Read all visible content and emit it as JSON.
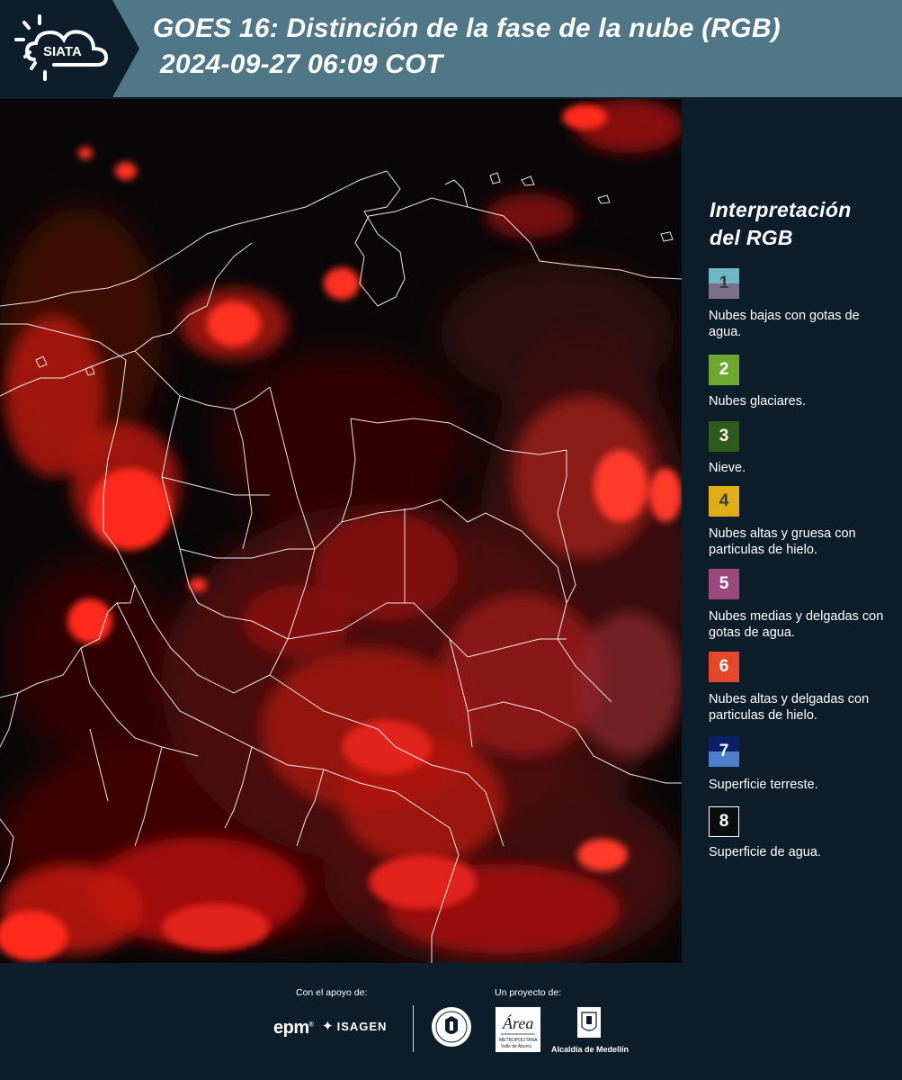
{
  "header": {
    "logo_text": "SIATA",
    "title_line1": "GOES 16: Distinción de la fase de la nube (RGB)",
    "title_line2": "2024-09-27 06:09 COT"
  },
  "legend": {
    "title_line1": "Interpretación",
    "title_line2": "del RGB",
    "items": [
      {
        "num": "1",
        "label": "Nubes bajas con gotas de agua.",
        "color_top": "#6fb6c6",
        "color_bottom": "#7b6f8a",
        "text_color": "#3a3a3a"
      },
      {
        "num": "2",
        "label": "Nubes glaciares.",
        "color": "#6ea72f",
        "text_color": "#ffffff"
      },
      {
        "num": "3",
        "label": "Nieve.",
        "color": "#2e5a1c",
        "text_color": "#ffffff"
      },
      {
        "num": "4",
        "label": "Nubes altas y gruesa con particulas de hielo.",
        "color": "#e1ad16",
        "text_color": "#3a3a3a"
      },
      {
        "num": "5",
        "label": "Nubes medias y delgadas con gotas de agua.",
        "color": "#9c4a7d",
        "text_color": "#ffffff"
      },
      {
        "num": "6",
        "label": "Nubes altas y delgadas con particulas de hielo.",
        "color": "#e4472a",
        "text_color": "#ffffff"
      },
      {
        "num": "7",
        "label": "Superficie terreste.",
        "color_top": "#0c1f6b",
        "color_bottom": "#4d7fcc",
        "text_color": "#ffffff"
      },
      {
        "num": "8",
        "label": "Superficie de agua.",
        "color": "#0a0f0d",
        "text_color": "#ffffff",
        "border": "#ffffff"
      }
    ]
  },
  "footer": {
    "support_label": "Con el apoyo de:",
    "project_label": "Un proyecto de:",
    "epm_logo_text": "epm",
    "isagen_logo_text": "ISAGEN",
    "amva_logo_text": "Área Metropolitana Valle de Aburrá",
    "alcaldia_label": "Alcaldía de Medellín"
  },
  "colors": {
    "header_bg": "#4f7787",
    "panel_bg": "#0d1e2a",
    "cloud_red": "#ff2a1a",
    "border_white": "#ffffff"
  }
}
